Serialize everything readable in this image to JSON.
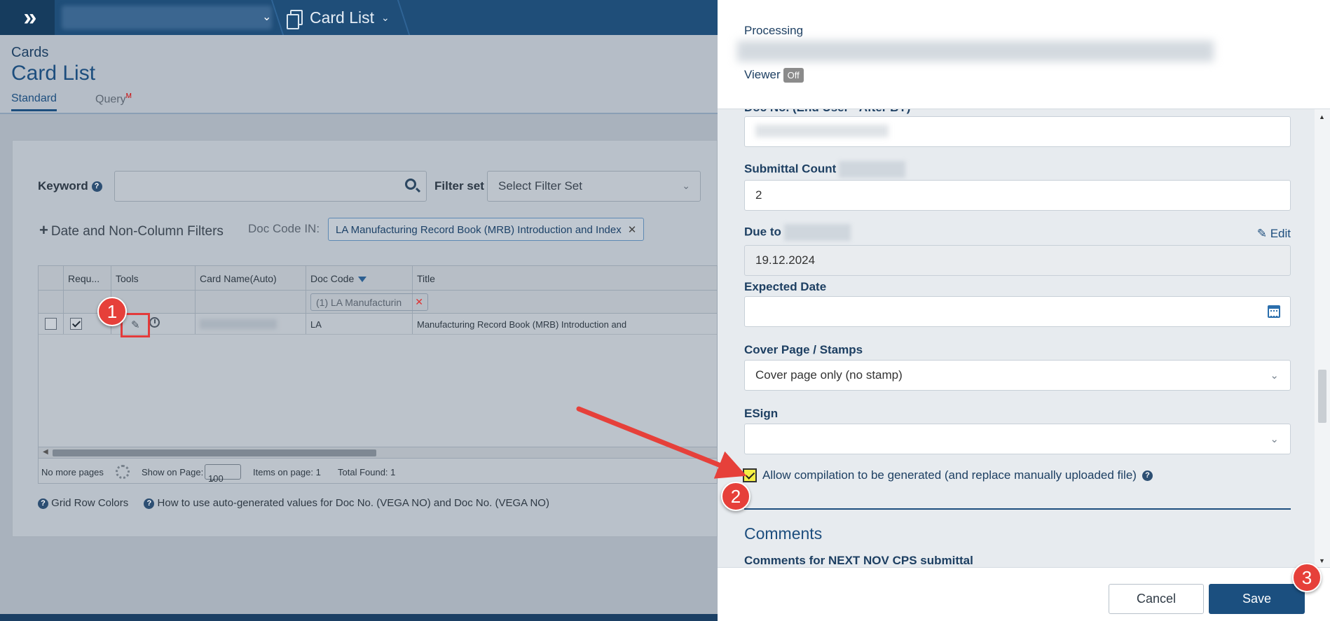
{
  "topbar": {
    "breadcrumb_current": "Card List",
    "colors": {
      "bar": "#1f4e79",
      "accent": "#1d4e7e"
    }
  },
  "header": {
    "module": "Cards",
    "title": "Card List",
    "tabs": [
      {
        "label": "Standard"
      },
      {
        "label": "Query",
        "badge": "M"
      }
    ]
  },
  "filters": {
    "keyword_label": "Keyword",
    "keyword_value": "",
    "filter_set_label": "Filter set",
    "filter_set_placeholder": "Select Filter Set",
    "date_filters_label": "Date and Non-Column Filters",
    "doc_code_in_label": "Doc Code IN:",
    "doc_code_chip": "LA Manufacturing Record Book (MRB) Introduction and Index"
  },
  "grid": {
    "columns": [
      "Requ...",
      "Tools",
      "Card Name(Auto)",
      "Doc Code",
      "Title"
    ],
    "doc_code_filter_chip": "(1) LA Manufacturin",
    "rows": [
      {
        "checked": false,
        "required": true,
        "doc_code": "LA",
        "title": "Manufacturing Record Book (MRB) Introduction and"
      }
    ],
    "pager": {
      "no_more_pages": "No more pages",
      "show_on_page_label": "Show on Page:",
      "page_size": "100",
      "items_on_page": "Items on page: 1",
      "total_found": "Total Found: 1"
    }
  },
  "footer_links": {
    "grid_row_colors": "Grid Row Colors",
    "how_to": "How to use auto-generated values for Doc No. (VEGA NO) and Doc No. (VEGA NO)"
  },
  "drawer": {
    "processing_label": "Processing",
    "viewer_label": "Viewer",
    "viewer_state": "Off",
    "fields": {
      "doc_no_label": "Doc No. (End User - After BY)",
      "submittal_count_label": "Submittal Count",
      "submittal_count_value": "2",
      "due_to_label": "Due to",
      "edit_label": "Edit",
      "due_to_value": "19.12.2024",
      "expected_date_label": "Expected Date",
      "expected_date_value": "",
      "cover_page_label": "Cover Page / Stamps",
      "cover_page_value": "Cover page only (no stamp)",
      "esign_label": "ESign",
      "esign_value": "",
      "allow_compilation_label": "Allow compilation to be generated (and replace manually uploaded file)",
      "allow_compilation_checked": true
    },
    "comments_title": "Comments",
    "comments_field_label": "Comments for NEXT NOV CPS submittal",
    "cancel_label": "Cancel",
    "save_label": "Save"
  },
  "annotations": {
    "step1": "1",
    "step2": "2",
    "step3": "3",
    "color": "#e6403a"
  }
}
